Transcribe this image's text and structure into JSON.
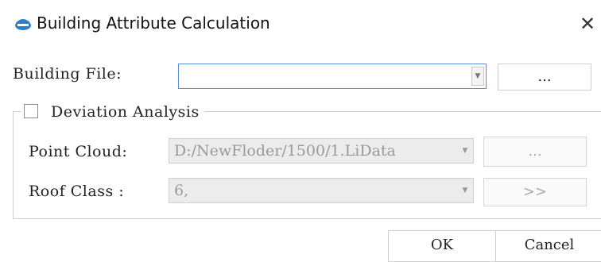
{
  "window": {
    "title": "Building Attribute Calculation",
    "close_symbol": "✕",
    "icon": "app-logo-icon"
  },
  "building_file": {
    "label": "Building File:",
    "value": "",
    "browse_label": "..."
  },
  "deviation_analysis": {
    "label": "Deviation Analysis",
    "checked": false,
    "point_cloud": {
      "label": "Point Cloud:",
      "value": "D:/NewFloder/1500/1.LiData",
      "browse_label": "..."
    },
    "roof_class": {
      "label": "Roof  Class :",
      "value": "6,",
      "expand_label": ">>"
    }
  },
  "footer": {
    "ok_label": "OK",
    "cancel_label": "Cancel"
  },
  "colors": {
    "accent_border": "#5a8ed6",
    "disabled_bg": "#ececec"
  }
}
